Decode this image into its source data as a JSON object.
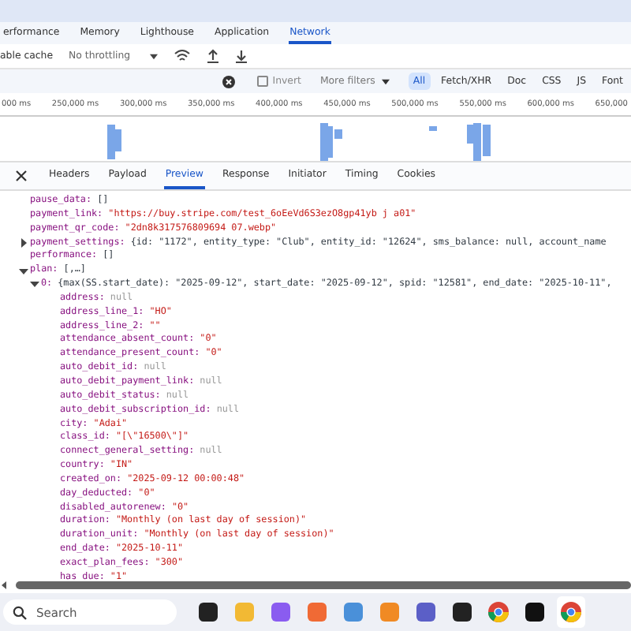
{
  "panel_tabs": [
    {
      "label": "erformance",
      "selected": false
    },
    {
      "label": "Memory",
      "selected": false
    },
    {
      "label": "Lighthouse",
      "selected": false
    },
    {
      "label": "Application",
      "selected": false
    },
    {
      "label": "Network",
      "selected": true
    }
  ],
  "toolbar": {
    "cache_label": "able cache",
    "throttling": "No throttling"
  },
  "filter_bar": {
    "invert": {
      "label": "Invert",
      "checked": false
    },
    "more_filters": "More filters",
    "types": [
      {
        "label": "All",
        "selected": true
      },
      {
        "label": "Fetch/XHR",
        "selected": false
      },
      {
        "label": "Doc",
        "selected": false
      },
      {
        "label": "CSS",
        "selected": false
      },
      {
        "label": "JS",
        "selected": false
      },
      {
        "label": "Font",
        "selected": false
      }
    ]
  },
  "timeline": {
    "ticks": [
      "000 ms",
      "250,000 ms",
      "300,000 ms",
      "350,000 ms",
      "400,000 ms",
      "450,000 ms",
      "500,000 ms",
      "550,000 ms",
      "600,000 ms",
      "650,000"
    ]
  },
  "detail_tabs": [
    {
      "label": "Headers",
      "selected": false
    },
    {
      "label": "Payload",
      "selected": false
    },
    {
      "label": "Preview",
      "selected": true
    },
    {
      "label": "Response",
      "selected": false
    },
    {
      "label": "Initiator",
      "selected": false
    },
    {
      "label": "Timing",
      "selected": false
    },
    {
      "label": "Cookies",
      "selected": false
    }
  ],
  "preview": [
    {
      "key": "pause_data:",
      "value": "[]",
      "kind": "summary"
    },
    {
      "key": "payment_link:",
      "value": "\"https://buy.stripe.com/test_6oEeVd6S3ezO8gp41yb j a01\"",
      "kind": "string"
    },
    {
      "key": "payment_qr_code:",
      "value": "\"2dn8k317576809694 07.webp\"",
      "kind": "string"
    },
    {
      "key": "payment_settings:",
      "value": "{id: \"1172\", entity_type: \"Club\", entity_id: \"12624\", sms_balance: null, account_name",
      "kind": "summary",
      "expanded": false
    },
    {
      "key": "performance:",
      "value": "[]",
      "kind": "summary"
    },
    {
      "key": "plan:",
      "value": "[,…]",
      "kind": "summary",
      "expanded": true,
      "children": [
        {
          "key": "0:",
          "value": "{max(SS.start_date): \"2025-09-12\", start_date: \"2025-09-12\", spid: \"12581\", end_date: \"2025-10-11\",",
          "kind": "summary",
          "expanded": true,
          "children": [
            {
              "key": "address:",
              "value": "null",
              "kind": "null"
            },
            {
              "key": "address_line_1:",
              "value": "\"HO\"",
              "kind": "string"
            },
            {
              "key": "address_line_2:",
              "value": "\"\"",
              "kind": "string"
            },
            {
              "key": "attendance_absent_count:",
              "value": "\"0\"",
              "kind": "string"
            },
            {
              "key": "attendance_present_count:",
              "value": "\"0\"",
              "kind": "string"
            },
            {
              "key": "auto_debit_id:",
              "value": "null",
              "kind": "null"
            },
            {
              "key": "auto_debit_payment_link:",
              "value": "null",
              "kind": "null"
            },
            {
              "key": "auto_debit_status:",
              "value": "null",
              "kind": "null"
            },
            {
              "key": "auto_debit_subscription_id:",
              "value": "null",
              "kind": "null"
            },
            {
              "key": "city:",
              "value": "\"Adai\"",
              "kind": "string"
            },
            {
              "key": "class_id:",
              "value": "\"[\\\"16500\\\"]\"",
              "kind": "string"
            },
            {
              "key": "connect_general_setting:",
              "value": "null",
              "kind": "null"
            },
            {
              "key": "country:",
              "value": "\"IN\"",
              "kind": "string"
            },
            {
              "key": "created_on:",
              "value": "\"2025-09-12 00:00:48\"",
              "kind": "string"
            },
            {
              "key": "day_deducted:",
              "value": "\"0\"",
              "kind": "string"
            },
            {
              "key": "disabled_autorenew:",
              "value": "\"0\"",
              "kind": "string"
            },
            {
              "key": "duration:",
              "value": "\"Monthly (on last day of session)\"",
              "kind": "string"
            },
            {
              "key": "duration_unit:",
              "value": "\"Monthly (on last day of session)\"",
              "kind": "string"
            },
            {
              "key": "end_date:",
              "value": "\"2025-10-11\"",
              "kind": "string"
            },
            {
              "key": "exact_plan_fees:",
              "value": "\"300\"",
              "kind": "string"
            },
            {
              "key": "has due:",
              "value": "\"1\"",
              "kind": "string"
            }
          ]
        }
      ]
    }
  ],
  "taskbar": {
    "search_placeholder": "Search"
  }
}
